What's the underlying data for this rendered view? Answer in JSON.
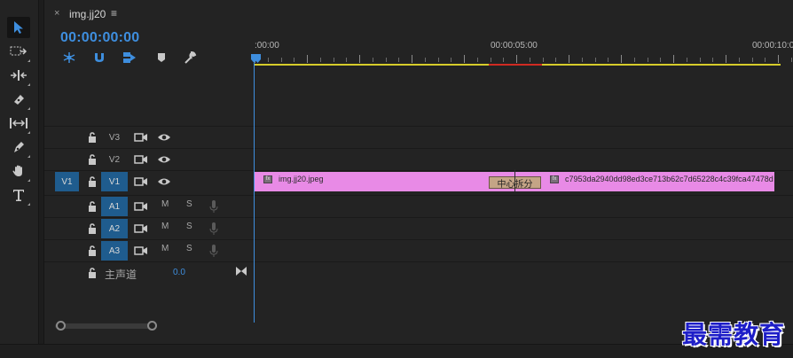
{
  "tab": {
    "close_glyph": "×",
    "title": "img.jj20",
    "menu_glyph": "≡"
  },
  "timecode": "00:00:00:00",
  "header_icons": [
    "snap-insert-icon",
    "magnet-icon",
    "linked-selection-icon",
    "marker-icon",
    "wrench-icon"
  ],
  "ruler": {
    "labels": [
      ":00:00",
      "00:00:05:00",
      "00:00:10:00"
    ]
  },
  "tools": [
    "selection-tool-icon",
    "track-select-tool-icon",
    "ripple-edit-tool-icon",
    "razor-tool-icon",
    "slip-tool-icon",
    "pen-tool-icon",
    "hand-tool-icon",
    "type-tool-icon"
  ],
  "video_tracks": [
    {
      "name": "V3",
      "source": "",
      "targeted": false
    },
    {
      "name": "V2",
      "source": "",
      "targeted": false
    },
    {
      "name": "V1",
      "source": "V1",
      "targeted": true
    }
  ],
  "audio_tracks": [
    {
      "name": "A1",
      "m": "M",
      "s": "S"
    },
    {
      "name": "A2",
      "m": "M",
      "s": "S"
    },
    {
      "name": "A3",
      "m": "M",
      "s": "S"
    }
  ],
  "master": {
    "label": "主声道",
    "value": "0.0"
  },
  "clips": {
    "clip1": {
      "fx": "fx",
      "name": "img.jj20.jpeg"
    },
    "transition": {
      "label": "中心拆分"
    },
    "clip2": {
      "fx": "fx",
      "name": "c7953da2940dd98ed3ce713b62c7d65228c4c39fca47478d"
    }
  },
  "watermark": "最需教育",
  "colors": {
    "accent": "#3e8ede",
    "clip": "#e88ae6",
    "work_area": "#d6cc2a",
    "render_bar": "#d02a22",
    "track_target": "#1f5c8e"
  }
}
